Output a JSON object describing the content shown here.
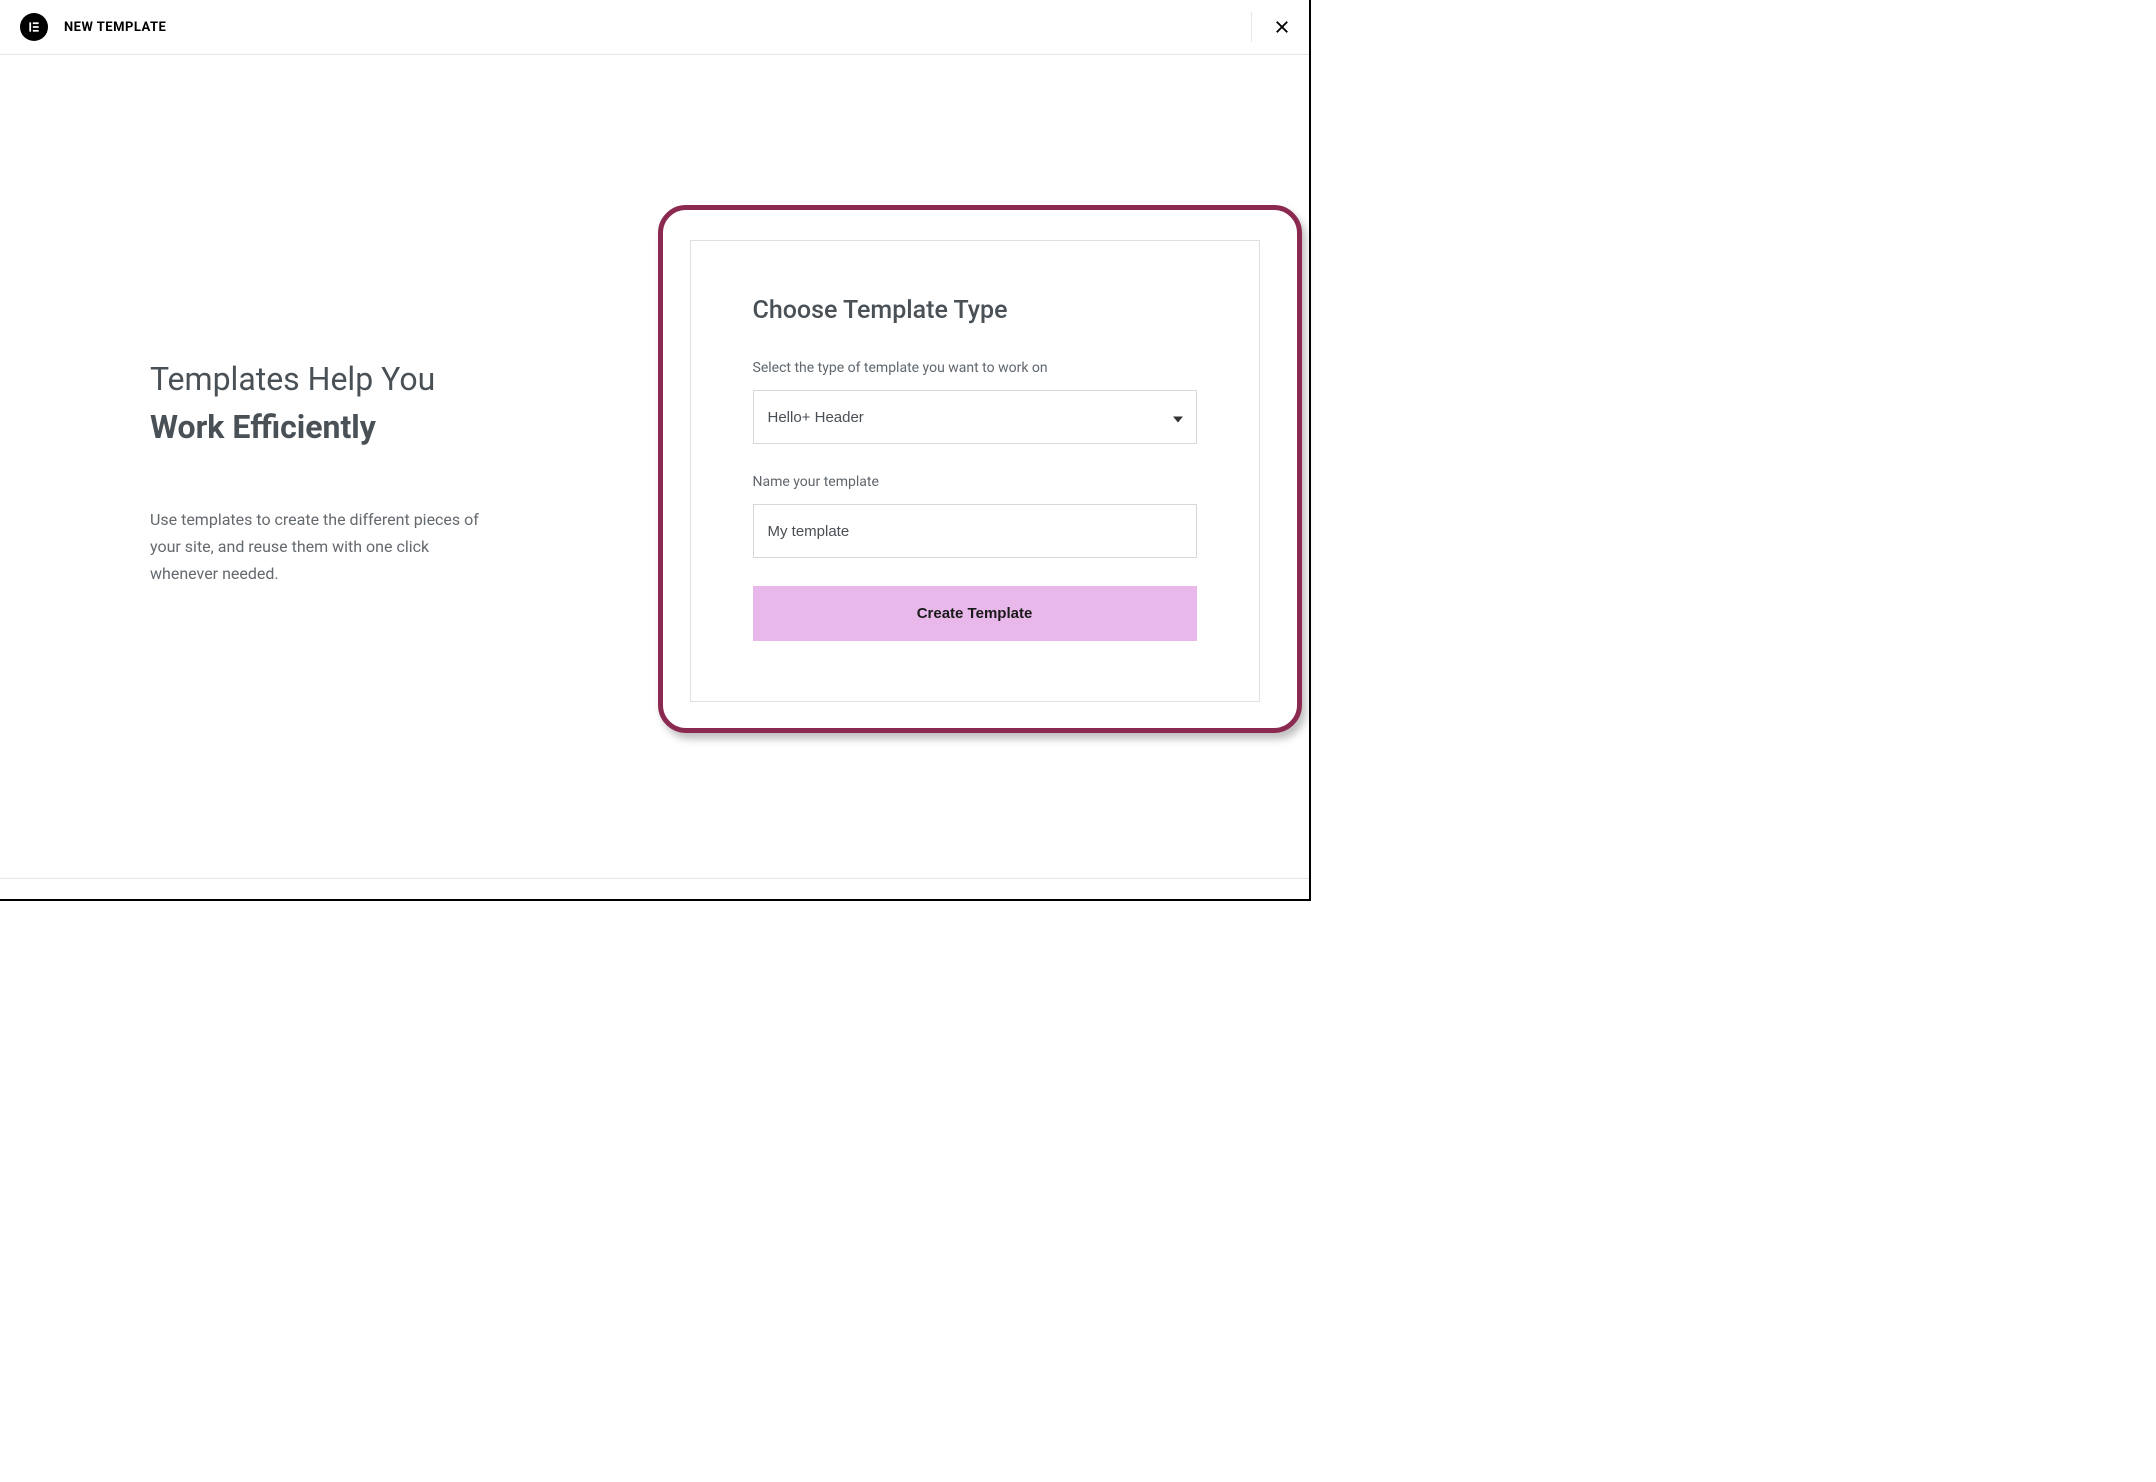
{
  "header": {
    "title": "NEW TEMPLATE",
    "logo_letter": "E"
  },
  "hero": {
    "title_line1": "Templates Help You",
    "title_line2": "Work Efficiently",
    "description": "Use templates to create the different pieces of your site, and reuse them with one click whenever needed."
  },
  "form": {
    "title": "Choose Template Type",
    "type_label": "Select the type of template you want to work on",
    "type_value": "Hello+ Header",
    "name_label": "Name your template",
    "name_value": "My template",
    "submit_label": "Create Template"
  }
}
